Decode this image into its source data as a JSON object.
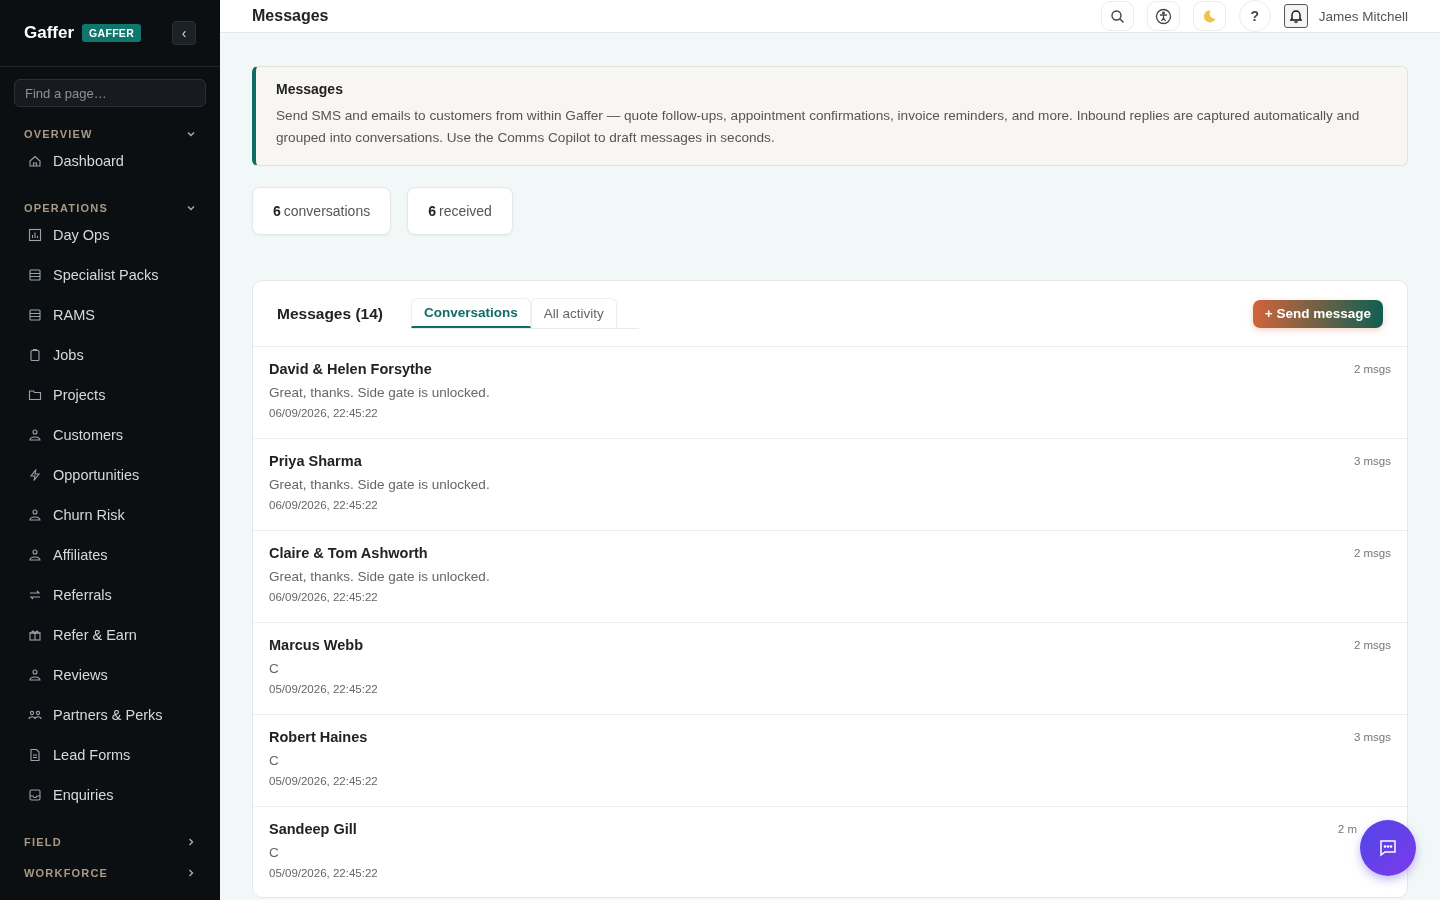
{
  "sidebar": {
    "brand": "Gaffer",
    "badge": "GAFFER",
    "collapse_button": "‹",
    "search": {
      "placeholder": "Find a page…"
    },
    "sections": [
      {
        "title": "OVERVIEW",
        "expanded": true,
        "items": [
          {
            "label": "Dashboard"
          }
        ]
      },
      {
        "title": "OPERATIONS",
        "expanded": true,
        "items": [
          {
            "label": "Day Ops"
          },
          {
            "label": "Specialist Packs"
          },
          {
            "label": "RAMS"
          },
          {
            "label": "Jobs"
          },
          {
            "label": "Projects"
          },
          {
            "label": "Customers"
          },
          {
            "label": "Opportunities"
          },
          {
            "label": "Churn Risk"
          },
          {
            "label": "Affiliates"
          },
          {
            "label": "Referrals"
          },
          {
            "label": "Refer & Earn"
          },
          {
            "label": "Reviews"
          },
          {
            "label": "Partners & Perks"
          },
          {
            "label": "Lead Forms"
          },
          {
            "label": "Enquiries"
          }
        ]
      },
      {
        "title": "FIELD",
        "expanded": false
      },
      {
        "title": "WORKFORCE",
        "expanded": false
      }
    ]
  },
  "header": {
    "title": "Messages",
    "user": "James Mitchell",
    "help": "?"
  },
  "info_banner": {
    "title": "Messages",
    "text": "Send SMS and emails to customers from within Gaffer — quote follow-ups, appointment confirmations, invoice reminders, and more. Inbound replies are captured automatically and grouped into conversations. Use the Comms Copilot to draft messages in seconds."
  },
  "stats": [
    "**6** conversations",
    "**6** received"
  ],
  "messages": {
    "title": "Messages (14)",
    "tabs": [
      {
        "label": "Conversations",
        "selected": true
      },
      {
        "label": "All activity",
        "selected": false
      }
    ],
    "send_button": "+ Send message",
    "conversations": [
      {
        "name": "David & Helen Forsythe",
        "preview": "Great, thanks. Side gate is unlocked.",
        "time": "06/09/2026, 22:45:22",
        "count": "2 msgs"
      },
      {
        "name": "Priya Sharma",
        "preview": "Great, thanks. Side gate is unlocked.",
        "time": "06/09/2026, 22:45:22",
        "count": "3 msgs"
      },
      {
        "name": "Claire & Tom Ashworth",
        "preview": "Great, thanks. Side gate is unlocked.",
        "time": "06/09/2026, 22:45:22",
        "count": "2 msgs"
      },
      {
        "name": "Marcus Webb",
        "preview": "C",
        "time": "05/09/2026, 22:45:22",
        "count": "2 msgs"
      },
      {
        "name": "Robert Haines",
        "preview": "C",
        "time": "05/09/2026, 22:45:22",
        "count": "3 msgs"
      },
      {
        "name": "Sandeep Gill",
        "preview": "C",
        "time": "05/09/2026, 22:45:22",
        "count": "2 m"
      }
    ]
  }
}
